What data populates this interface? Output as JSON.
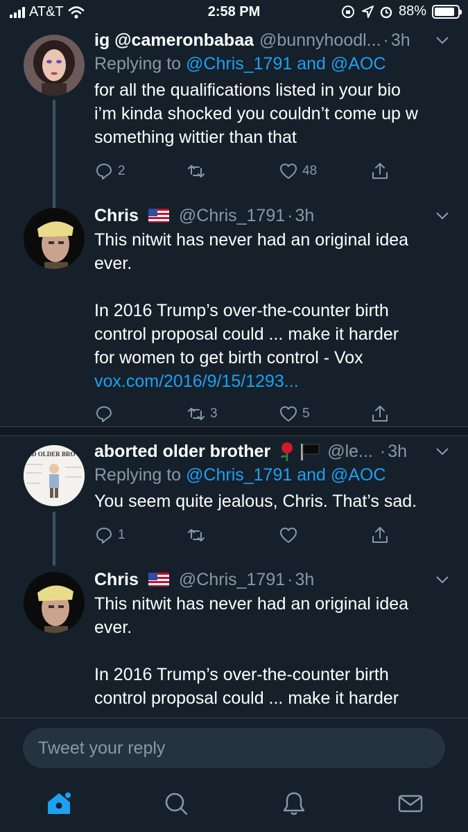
{
  "status_bar": {
    "carrier": "AT&T",
    "time": "2:58 PM",
    "battery": "88%",
    "battery_level": 0.88
  },
  "tweets": [
    {
      "name": "ig @cameronbabaa",
      "handle": "@bunnyhoodl...",
      "time": "3h",
      "replying_prefix": "Replying to",
      "replying_user1": "@Chris_1791",
      "replying_and": "and",
      "replying_user2": "@AOC",
      "text_lines": [
        "for all the qualifications listed in your bio",
        "i’m kinda shocked you couldn’t come up w",
        "something wittier than that"
      ],
      "reply_count": "2",
      "retweet_count": "",
      "like_count": "48"
    },
    {
      "name": "Chris",
      "handle": "@Chris_1791",
      "time": "3h",
      "text_lines": [
        "This nitwit has never had an original idea",
        "ever.",
        "In 2016 Trump’s over-the-counter birth",
        "control proposal could ... make it harder",
        "for women to get birth control - Vox"
      ],
      "link": "vox.com/2016/9/15/1293...",
      "reply_count": "",
      "retweet_count": "3",
      "like_count": "5"
    },
    {
      "name": "aborted older brother",
      "handle": "@le...",
      "time": "3h",
      "replying_prefix": "Replying to",
      "replying_user1": "@Chris_1791",
      "replying_and": "and",
      "replying_user2": "@AOC",
      "text_lines": [
        "You seem quite jealous, Chris. That’s sad."
      ],
      "reply_count": "1",
      "retweet_count": "",
      "like_count": ""
    },
    {
      "name": "Chris",
      "handle": "@Chris_1791",
      "time": "3h",
      "text_lines": [
        "This nitwit has never had an original idea",
        "ever.",
        "In 2016 Trump’s over-the-counter birth",
        "control proposal could ... make it harder"
      ]
    }
  ],
  "composer": {
    "placeholder": "Tweet your reply"
  },
  "tabbar": {
    "items": [
      "home-icon",
      "search-icon",
      "notifications-icon",
      "messages-icon"
    ]
  },
  "colors": {
    "background": "#15202b",
    "accent": "#1da1f2",
    "muted": "#8899a6"
  }
}
